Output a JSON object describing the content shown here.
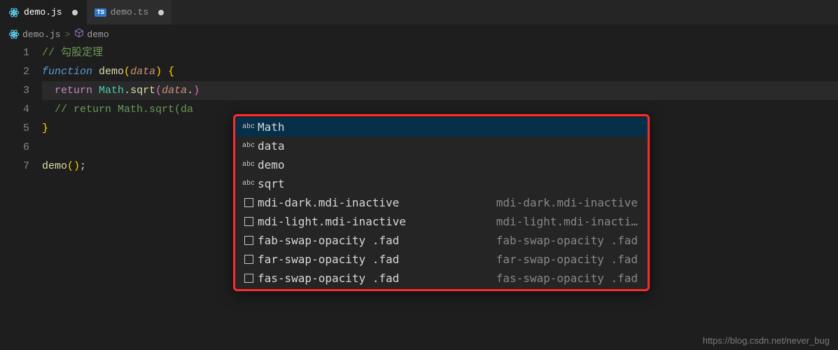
{
  "tabs": [
    {
      "icon": "react",
      "label": "demo.js",
      "active": true,
      "dirty": true
    },
    {
      "icon": "ts",
      "label": "demo.ts",
      "active": false,
      "dirty": true
    }
  ],
  "breadcrumbs": {
    "file_icon": "react",
    "file": "demo.js",
    "sep": ">",
    "symbol_icon": "cube",
    "symbol": "demo"
  },
  "code": {
    "lines": [
      {
        "n": "1",
        "html": "<span class='tok-comment'>// 勾股定理</span>"
      },
      {
        "n": "2",
        "html": "<span class='tok-storage'>function</span> <span class='tok-fn'>demo</span><span class='tok-brace1'>(</span><span class='tok-param'>data</span><span class='tok-brace1'>)</span> <span class='tok-brace1'>{</span>"
      },
      {
        "n": "3",
        "html": "  <span class='tok-return'>return</span> <span class='tok-obj'>Math</span><span class='tok-punct'>.</span><span class='tok-method'>sqrt</span><span class='tok-brace2'>(</span><span class='tok-param'>data</span><span class='tok-punct'>.</span><span class='tok-brace2'>)</span>",
        "highlight": true
      },
      {
        "n": "4",
        "html": "  <span class='tok-comment'>// return Math.sqrt(da</span>"
      },
      {
        "n": "5",
        "html": "<span class='tok-brace1'>}</span>"
      },
      {
        "n": "6",
        "html": ""
      },
      {
        "n": "7",
        "html": "<span class='tok-fn'>demo</span><span class='tok-brace1'>(</span><span class='tok-brace1'>)</span><span class='tok-punct'>;</span>"
      }
    ]
  },
  "autocomplete": {
    "items": [
      {
        "kind": "abc",
        "label": "Math",
        "detail": "",
        "selected": true
      },
      {
        "kind": "abc",
        "label": "data",
        "detail": ""
      },
      {
        "kind": "abc",
        "label": "demo",
        "detail": ""
      },
      {
        "kind": "abc",
        "label": "sqrt",
        "detail": ""
      },
      {
        "kind": "box",
        "label": "mdi-dark.mdi-inactive",
        "detail": "mdi-dark.mdi-inactive"
      },
      {
        "kind": "box",
        "label": "mdi-light.mdi-inactive",
        "detail": "mdi-light.mdi-inacti…"
      },
      {
        "kind": "box",
        "label": "fab-swap-opacity .fad",
        "detail": "fab-swap-opacity .fad"
      },
      {
        "kind": "box",
        "label": "far-swap-opacity .fad",
        "detail": "far-swap-opacity .fad"
      },
      {
        "kind": "box",
        "label": "fas-swap-opacity .fad",
        "detail": "fas-swap-opacity .fad"
      }
    ]
  },
  "watermark": "https://blog.csdn.net/never_bug"
}
